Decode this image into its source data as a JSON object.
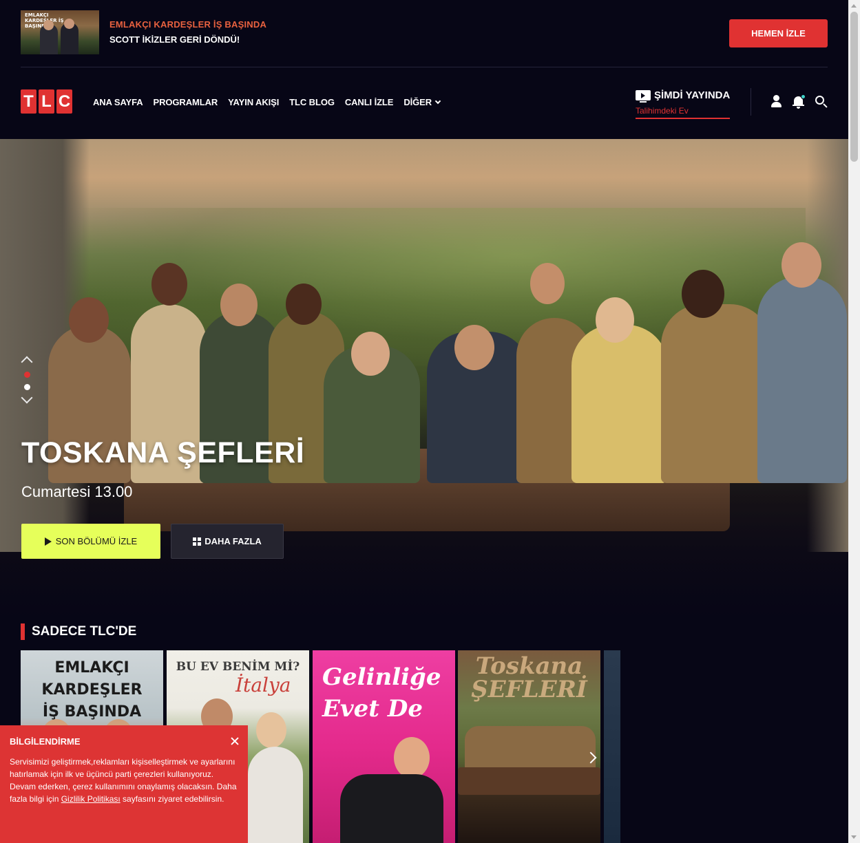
{
  "promo": {
    "thumb_text": "EMLAKÇI KARDEŞLER İŞ BAŞINDA",
    "line1": "EMLAKÇI KARDEŞLER İŞ BAŞINDA",
    "line2": "SCOTT İKİZLER GERİ DÖNDÜ!",
    "button": "HEMEN İZLE"
  },
  "logo": [
    "T",
    "L",
    "C"
  ],
  "menu": {
    "items": [
      "ANA SAYFA",
      "PROGRAMLAR",
      "YAYIN AKIŞI",
      "TLC BLOG",
      "CANLI İZLE"
    ],
    "more": "DİĞER"
  },
  "live": {
    "label": "ŞİMDİ YAYINDA",
    "show": "Talihimdeki Ev"
  },
  "hero": {
    "title": "TOSKANA ŞEFLERİ",
    "time": "Cumartesi 13.00",
    "watch_button": "SON BÖLÜMÜ İZLE",
    "more_button": "DAHA FAZLA",
    "active_slide": 1,
    "slide_count": 2
  },
  "section": {
    "title": "SADECE TLC'DE",
    "cards": [
      {
        "title": "EMLAKÇI KARDEŞLER\nİŞ BAŞINDA"
      },
      {
        "title": "BU EV BENİM Mİ?",
        "subtitle": "İtalya"
      },
      {
        "title": "Gelinliğe\nEvet De"
      },
      {
        "title": "Toskana\nŞEFLERİ"
      }
    ]
  },
  "cookie": {
    "title": "BİLGİLENDİRME",
    "text_before": "Servisimizi geliştirmek,reklamları kişiselleştirmek ve ayarlarını hatırlamak için ilk ve üçüncü parti çerezleri kullanıyoruz. Devam ederken, çerez kullanımını onaylamış olacaksın. Daha fazla bilgi için ",
    "link": "Gizlilik Politikası",
    "text_after": " sayfasını ziyaret edebilirsin."
  },
  "colors": {
    "brand_red": "#e03232",
    "accent_lime": "#e6ff5a",
    "background": "#070616"
  }
}
